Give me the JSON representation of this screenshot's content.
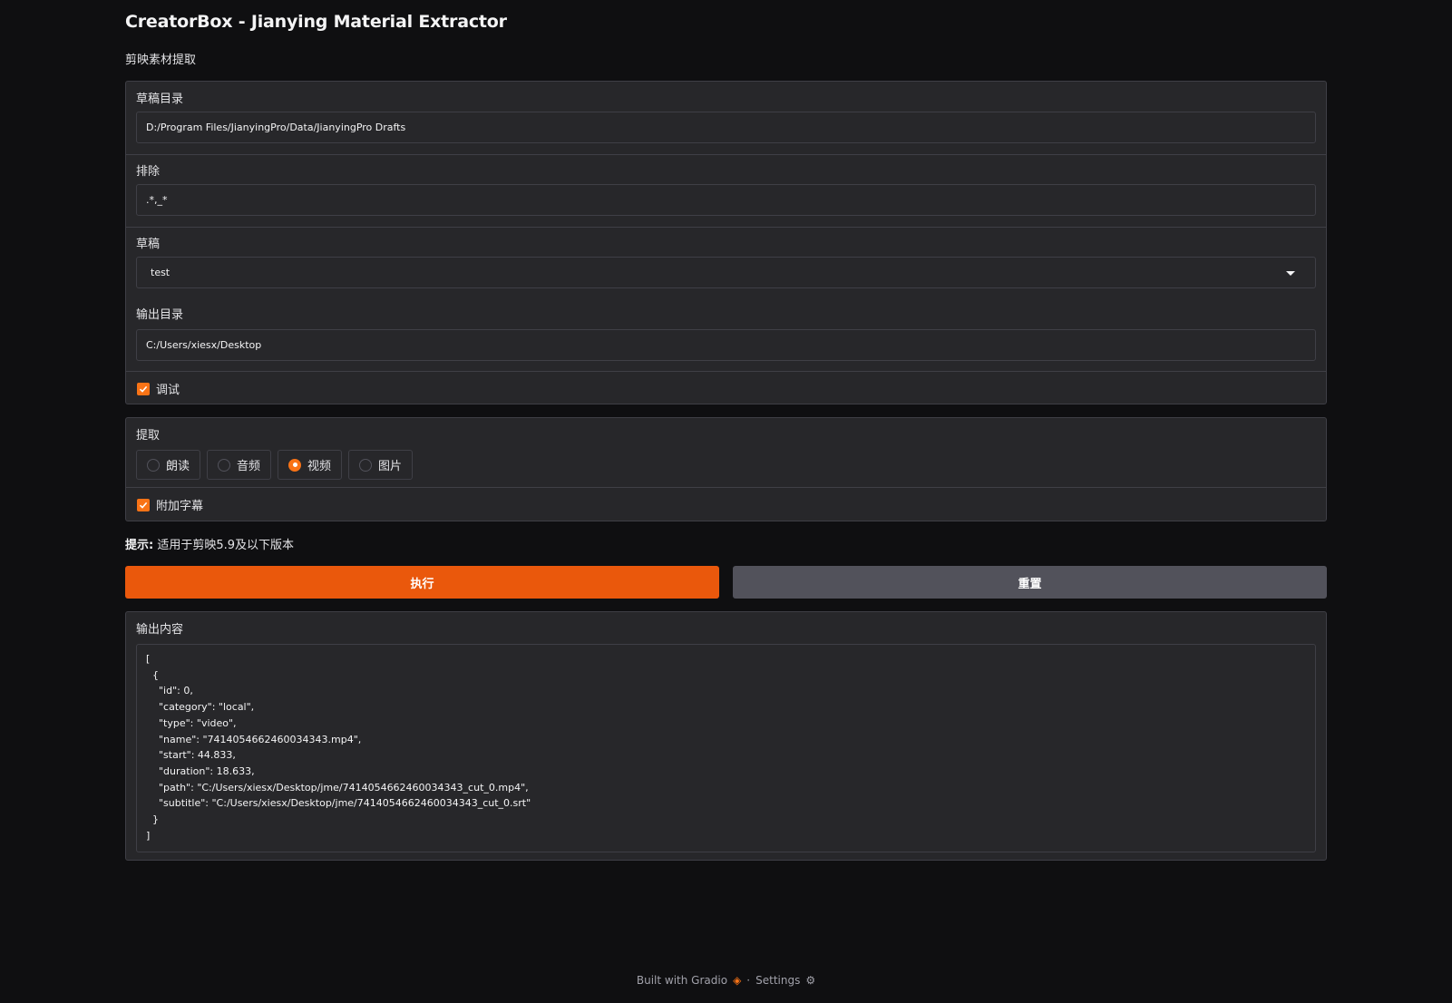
{
  "app": {
    "title": "CreatorBox - Jianying Material Extractor",
    "subtitle": "剪映素材提取"
  },
  "form": {
    "drafts_dir_label": "草稿目录",
    "drafts_dir_value": "D:/Program Files/JianyingPro/Data/JianyingPro Drafts",
    "exclude_label": "排除",
    "exclude_value": ".*,_*",
    "draft_label": "草稿",
    "draft_value": "test",
    "output_dir_label": "输出目录",
    "output_dir_value": "C:/Users/xiesx/Desktop",
    "debug_label": "调试",
    "debug_checked": true
  },
  "extract": {
    "label": "提取",
    "options": [
      "朗读",
      "音频",
      "视频",
      "图片"
    ],
    "selected": "视频",
    "subtitle_label": "附加字幕",
    "subtitle_checked": true
  },
  "hint": {
    "prefix": "提示:",
    "text": "适用于剪映5.9及以下版本"
  },
  "buttons": {
    "run": "执行",
    "reset": "重置"
  },
  "output": {
    "label": "输出内容",
    "content": "[\n  {\n    \"id\": 0,\n    \"category\": \"local\",\n    \"type\": \"video\",\n    \"name\": \"7414054662460034343.mp4\",\n    \"start\": 44.833,\n    \"duration\": 18.633,\n    \"path\": \"C:/Users/xiesx/Desktop/jme/7414054662460034343_cut_0.mp4\",\n    \"subtitle\": \"C:/Users/xiesx/Desktop/jme/7414054662460034343_cut_0.srt\"\n  }\n]"
  },
  "footer": {
    "built_with": "Built with Gradio",
    "separator": "·",
    "settings": "Settings"
  },
  "colors": {
    "accent": "#ea580c",
    "checkbox": "#f97316",
    "background": "#0f0f11",
    "panel": "#27272a"
  }
}
